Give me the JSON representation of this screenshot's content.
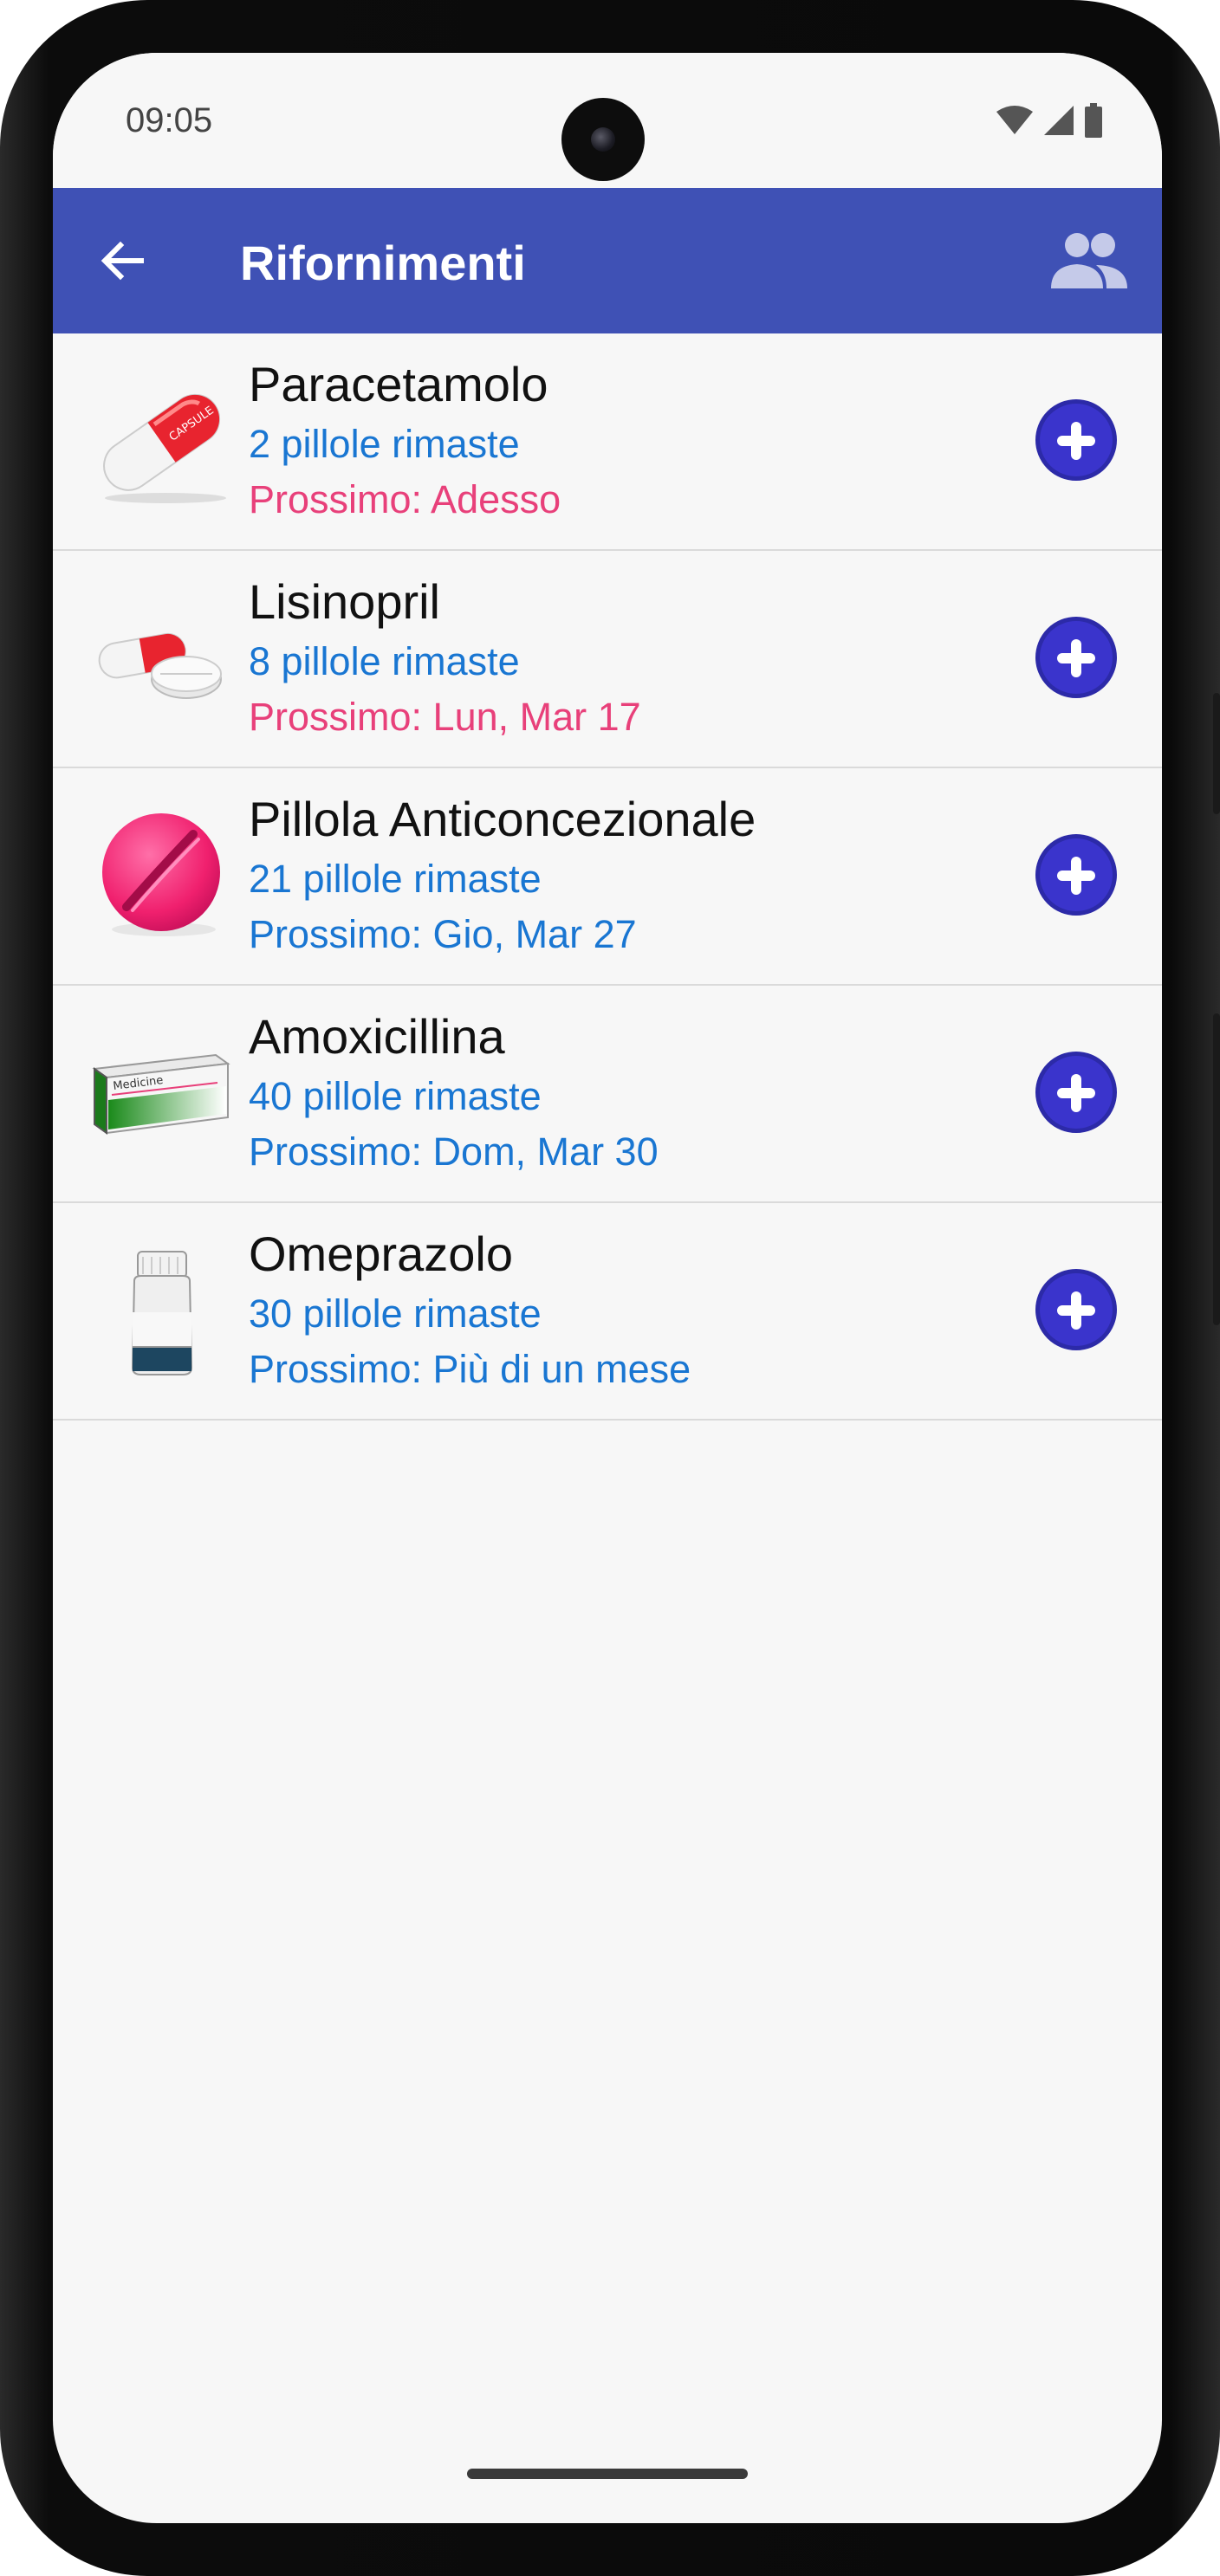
{
  "status_bar": {
    "time": "09:05"
  },
  "app_bar": {
    "title": "Rifornimenti"
  },
  "refills": [
    {
      "name": "Paracetamolo",
      "remaining": "2 pillole rimaste",
      "next": "Prossimo: Adesso",
      "icon": "red-capsule-icon",
      "capsule_text": "CAPSULE"
    },
    {
      "name": "Lisinopril",
      "remaining": "8 pillole rimaste",
      "next": "Prossimo: Lun, Mar 17",
      "icon": "capsule-and-tablet-icon"
    },
    {
      "name": "Pillola Anticoncezionale",
      "remaining": "21 pillole rimaste",
      "next": "Prossimo: Gio, Mar 27",
      "icon": "pink-tablet-icon"
    },
    {
      "name": "Amoxicillina",
      "remaining": "40 pillole rimaste",
      "next": "Prossimo: Dom, Mar 30",
      "icon": "medicine-box-icon",
      "box_text": "Medicine"
    },
    {
      "name": "Omeprazolo",
      "remaining": "30 pillole rimaste",
      "next": "Prossimo: Più di un mese",
      "icon": "pill-bottle-icon"
    }
  ],
  "colors": {
    "app_bar": "#3f51b5",
    "count_text": "#1976d2",
    "urgent_text": "#e8407a",
    "add_button": "#3a34cc"
  }
}
